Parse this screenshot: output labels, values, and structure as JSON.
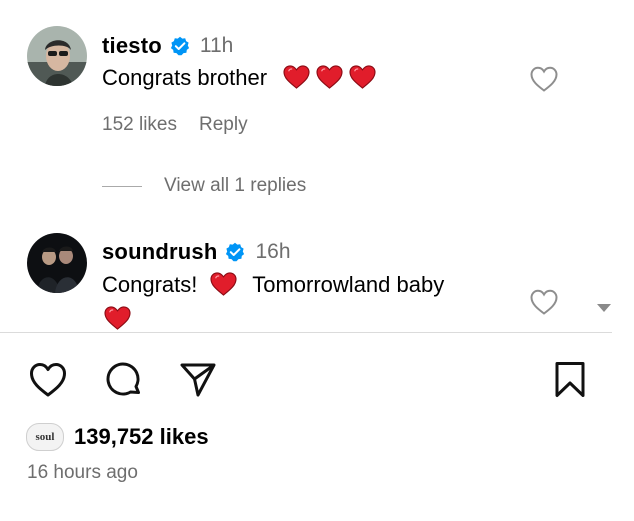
{
  "comments": [
    {
      "username": "tiesto",
      "time": "11h",
      "text": "Congrats brother",
      "emoji_count": 3,
      "likes": "152 likes",
      "reply_label": "Reply"
    },
    {
      "username": "soundrush",
      "time": "16h",
      "text_before": "Congrats!",
      "text_after": "Tomorrowland baby"
    }
  ],
  "view_replies": "View all 1 replies",
  "post": {
    "liker_avatar_text": "soul",
    "likes_count": "139,752 likes",
    "posted": "16 hours ago"
  },
  "icons": [
    "verified-badge-icon",
    "heart-outline-icon",
    "heart-emoji-icon",
    "comment-icon",
    "share-icon",
    "bookmark-icon",
    "scroll-down-arrow-icon"
  ],
  "colors": {
    "verified": "#0095f6",
    "heart_emoji": "#e11d2b",
    "secondary_text": "#6e6e6e"
  }
}
